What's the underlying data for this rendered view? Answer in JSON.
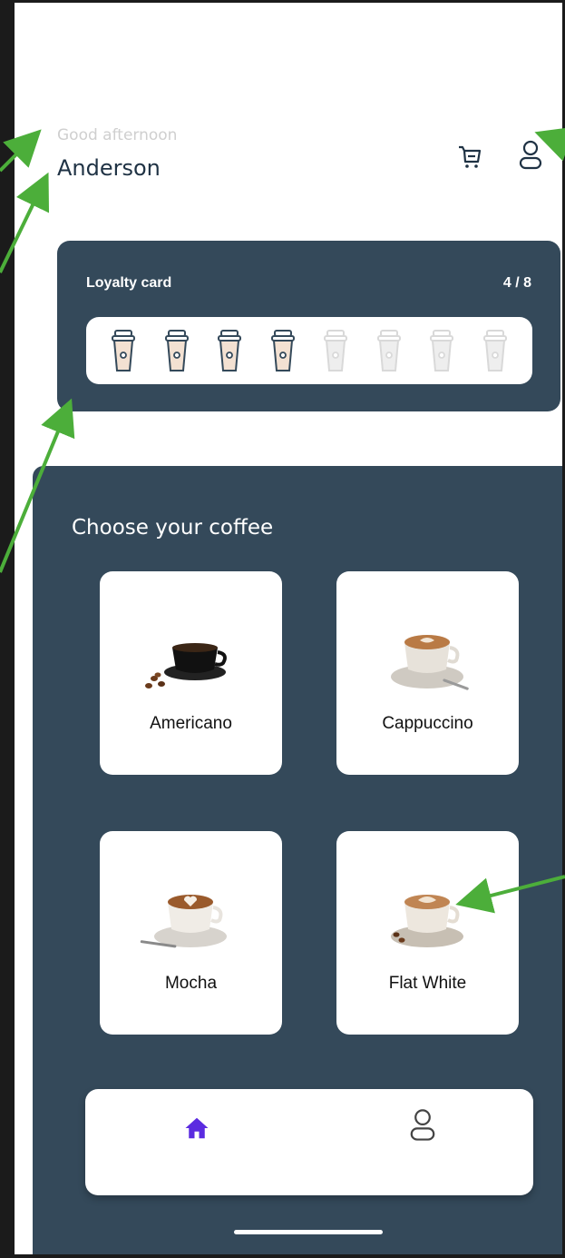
{
  "header": {
    "greeting": "Good afternoon",
    "username": "Anderson"
  },
  "loyalty": {
    "title": "Loyalty card",
    "count": "4 / 8",
    "stamps_total": 8,
    "stamps_filled": 4
  },
  "coffee": {
    "title": "Choose your coffee",
    "items": [
      {
        "name": "Americano"
      },
      {
        "name": "Cappuccino"
      },
      {
        "name": "Mocha"
      },
      {
        "name": "Flat White"
      }
    ]
  },
  "nav": {
    "active": "home",
    "items": [
      "home",
      "profile"
    ]
  },
  "colors": {
    "panel": "#34495a",
    "accent": "#5b2be0",
    "arrow": "#4cae3a"
  },
  "icons": [
    "cart-icon",
    "profile-icon",
    "cup-icon",
    "home-icon"
  ]
}
